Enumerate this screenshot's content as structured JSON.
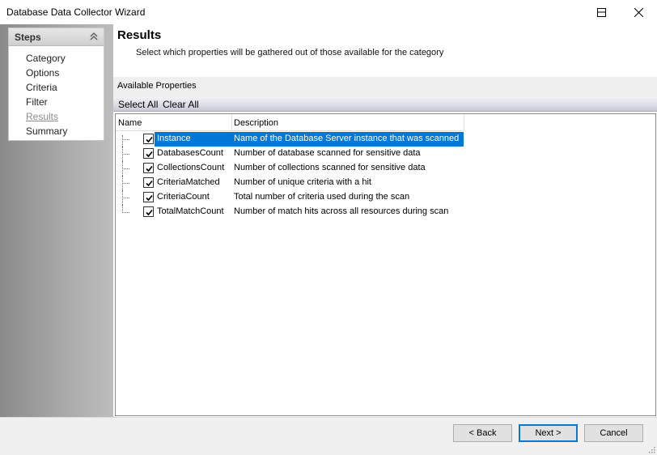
{
  "window": {
    "title": "Database Data Collector Wizard",
    "controls": [
      "minimize-icon",
      "maximize-icon",
      "close-icon"
    ]
  },
  "steps": {
    "header": "Steps",
    "items": [
      {
        "label": "Category",
        "active": false
      },
      {
        "label": "Options",
        "active": false
      },
      {
        "label": "Criteria",
        "active": false
      },
      {
        "label": "Filter",
        "active": false
      },
      {
        "label": "Results",
        "active": true
      },
      {
        "label": "Summary",
        "active": false
      }
    ]
  },
  "page": {
    "title": "Results",
    "subtitle": "Select which properties will be gathered out of those available for the category",
    "available_label": "Available Properties",
    "select_all": "Select All",
    "clear_all": "Clear All"
  },
  "grid": {
    "columns": [
      "Name",
      "Description"
    ],
    "rows": [
      {
        "name": "Instance",
        "description": "Name of the Database Server instance that was scanned",
        "checked": true,
        "selected": true
      },
      {
        "name": "DatabasesCount",
        "description": "Number of database scanned for sensitive data",
        "checked": true,
        "selected": false
      },
      {
        "name": "CollectionsCount",
        "description": "Number of collections scanned for sensitive data",
        "checked": true,
        "selected": false
      },
      {
        "name": "CriteriaMatched",
        "description": "Number of unique criteria with a hit",
        "checked": true,
        "selected": false
      },
      {
        "name": "CriteriaCount",
        "description": "Total number of criteria used during the scan",
        "checked": true,
        "selected": false
      },
      {
        "name": "TotalMatchCount",
        "description": "Number of match hits across all resources during scan",
        "checked": true,
        "selected": false
      }
    ]
  },
  "footer": {
    "back": "< Back",
    "next": "Next >",
    "cancel": "Cancel"
  },
  "colors": {
    "selection": "#0078d7",
    "accent_border": "#0078d7"
  }
}
